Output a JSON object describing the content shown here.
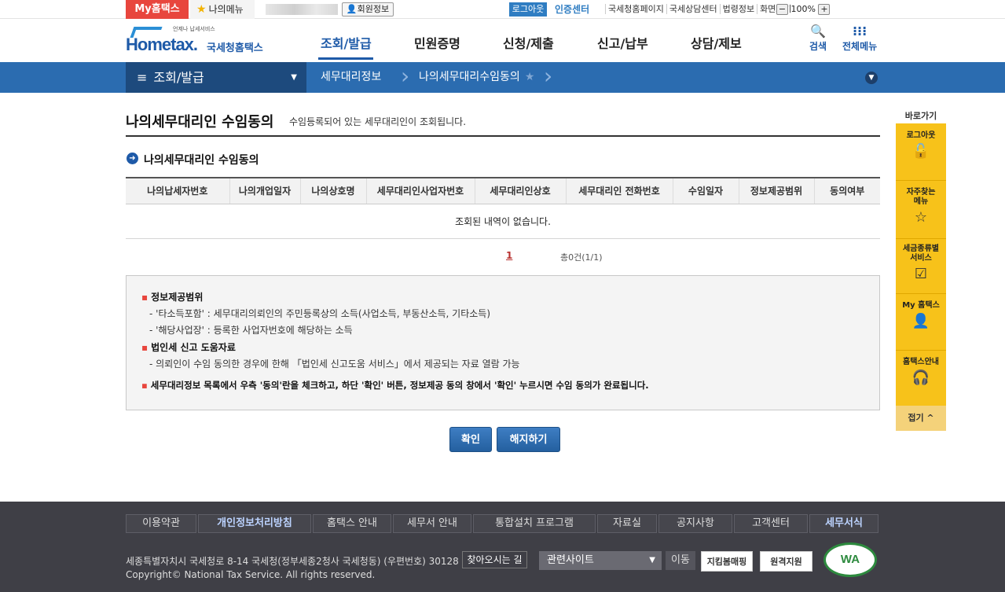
{
  "topbar": {
    "my_hometax": "My홈택스",
    "my_menu": "나의메뉴",
    "member_info": "회원정보",
    "logout": "로그아웃",
    "cert_center": "인증센터",
    "links": [
      "국세청홈페이지",
      "국세상담센터",
      "법령정보",
      "화면크기"
    ],
    "zoom_minus": "−",
    "zoom_level": "100%",
    "zoom_plus": "+"
  },
  "header": {
    "logo_small": "언제나 납세서비스",
    "logo_home": "Hometax.",
    "logo_kr": "국세청홈택스",
    "gnb": [
      "조회/발급",
      "민원증명",
      "신청/제출",
      "신고/납부",
      "상담/제보"
    ],
    "search": "검색",
    "all_menu": "전체메뉴"
  },
  "subnav": {
    "main": "조회/발급",
    "crumb1": "세무대리정보",
    "crumb2": "나의세무대리수임동의"
  },
  "page": {
    "title": "나의세무대리인 수임동의",
    "desc": "수임등록되어 있는 세무대리인이 조회됩니다.",
    "section_title": "나의세무대리인 수임동의"
  },
  "table": {
    "headers": [
      "나의납세자번호",
      "나의개업일자",
      "나의상호명",
      "세무대리인사업자번호",
      "세무대리인상호",
      "세무대리인 전화번호",
      "수임일자",
      "정보제공범위",
      "동의여부"
    ],
    "empty": "조회된 내역이 없습니다."
  },
  "pager": {
    "current": "1",
    "total": "총0건(1/1)"
  },
  "info": {
    "h1": "정보제공범위",
    "l1": "- '타소득포함' : 세무대리의뢰인의 주민등록상의 소득(사업소득, 부동산소득, 기타소득)",
    "l2": "- '해당사업장' : 등록한 사업자번호에 해당하는 소득",
    "h2": "법인세 신고 도움자료",
    "l3": "- 의뢰인이 수임 동의한 경우에 한해 「법인세 신고도움 서비스」에서 제공되는 자료 열람 가능",
    "h3": "세무대리정보 목록에서 우측 '동의'란을 체크하고, 하단 '확인' 버튼, 정보제공 동의 창에서 '확인' 누르시면 수임 동의가 완료됩니다."
  },
  "buttons": {
    "confirm": "확인",
    "cancel": "해지하기"
  },
  "quick": {
    "title": "바로가기",
    "items": [
      "로그아웃",
      "자주찾는 메뉴",
      "세금종류별 서비스",
      "My 홈택스",
      "홈택스안내"
    ],
    "fold": "접기 ^"
  },
  "footer": {
    "nav": [
      "이용약관",
      "개인정보처리방침",
      "홈택스 안내",
      "세무서 안내",
      "통합설치 프로그램",
      "자료실",
      "공지사항",
      "고객센터",
      "세무서식"
    ],
    "address": "세종특별자치시 국세청로 8-14 국세청(정부세종2청사 국세청동) (우편번호) 30128",
    "copyright": "Copyright© National Tax Service. All rights reserved.",
    "find_way": "찾아오시는 길",
    "related": "관련사이트",
    "move": "이동",
    "badge1": "지킴봄매핑",
    "badge2": "원격지원",
    "wa": "WA"
  },
  "colors": {
    "brand_blue": "#1e5aa8",
    "accent_red": "#e8463d",
    "quick_yellow": "#f7c21a"
  }
}
